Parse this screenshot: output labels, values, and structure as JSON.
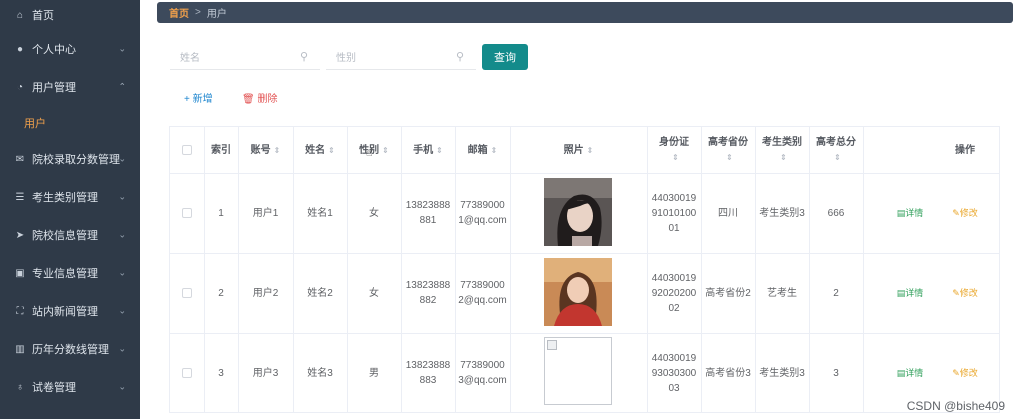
{
  "sidebar": {
    "items": [
      {
        "label": "首页",
        "icon": "home-icon",
        "expanded": false,
        "has_chevron": false
      },
      {
        "label": "个人中心",
        "icon": "user-icon",
        "expanded": false,
        "has_chevron": true
      },
      {
        "label": "用户管理",
        "icon": "user-manage-icon",
        "expanded": true,
        "has_chevron": true
      },
      {
        "label": "院校录取分数管理",
        "icon": "mail-icon",
        "expanded": false,
        "has_chevron": true
      },
      {
        "label": "考生类别管理",
        "icon": "sliders-icon",
        "expanded": false,
        "has_chevron": true
      },
      {
        "label": "院校信息管理",
        "icon": "send-icon",
        "expanded": false,
        "has_chevron": true
      },
      {
        "label": "专业信息管理",
        "icon": "clipboard-icon",
        "expanded": false,
        "has_chevron": true
      },
      {
        "label": "站内新闻管理",
        "icon": "fullscreen-icon",
        "expanded": false,
        "has_chevron": true
      },
      {
        "label": "历年分数线管理",
        "icon": "barcode-icon",
        "expanded": false,
        "has_chevron": true
      },
      {
        "label": "试卷管理",
        "icon": "mic-icon",
        "expanded": false,
        "has_chevron": true
      }
    ],
    "sub_item": "用户"
  },
  "breadcrumb": {
    "home": "首页",
    "sep": ">",
    "current": "用户"
  },
  "search": {
    "name_placeholder": "姓名",
    "gender_placeholder": "性别",
    "query_label": "查询"
  },
  "toolbar": {
    "add_label": "+ 新增",
    "delete_label": "🗑 删除"
  },
  "table": {
    "headers": [
      "索引",
      "账号",
      "姓名",
      "性别",
      "手机",
      "邮箱",
      "照片",
      "身份证",
      "高考省份",
      "考生类别",
      "高考总分",
      "操作"
    ],
    "rows": [
      {
        "index": "1",
        "account": "用户1",
        "name": "姓名1",
        "gender": "女",
        "phone": "13823888881",
        "email": "773890001@qq.com",
        "id_card": "440300199101010001",
        "province": "四川",
        "category": "考生类别3",
        "score": "666",
        "photo": "girl-1"
      },
      {
        "index": "2",
        "account": "用户2",
        "name": "姓名2",
        "gender": "女",
        "phone": "13823888882",
        "email": "773890002@qq.com",
        "id_card": "440300199202020002",
        "province": "高考省份2",
        "category": "艺考生",
        "score": "2",
        "photo": "girl-2"
      },
      {
        "index": "3",
        "account": "用户3",
        "name": "姓名3",
        "gender": "男",
        "phone": "13823888883",
        "email": "773890003@qq.com",
        "id_card": "440300199303030003",
        "province": "高考省份3",
        "category": "考生类别3",
        "score": "3",
        "photo": "broken"
      }
    ],
    "actions": {
      "detail": "详情",
      "edit": "修改"
    }
  },
  "watermark": "CSDN @bishe409",
  "colors": {
    "sidebar": "#2f3a48",
    "accent": "#f0a04b",
    "query": "#138b8b",
    "add": "#1e86cf",
    "delete": "#e25151",
    "detail": "#2f9f5a",
    "edit": "#e9a62a"
  }
}
